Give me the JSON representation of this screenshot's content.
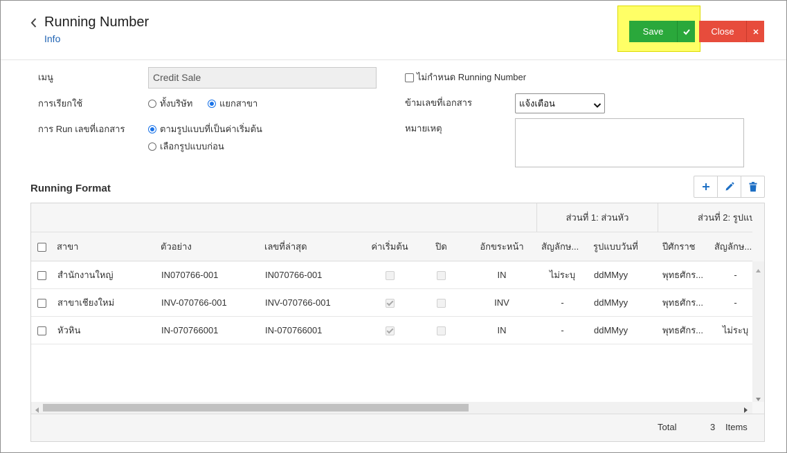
{
  "header": {
    "back_icon": "chevron-left-icon",
    "title": "Running Number",
    "subtitle": "Info",
    "save_label": "Save",
    "save_menu_icon": "check-icon",
    "close_label": "Close",
    "close_icon": "close-icon"
  },
  "form": {
    "menu": {
      "label": "เมนู",
      "value": "Credit Sale"
    },
    "usage": {
      "label": "การเรียกใช้",
      "options": [
        {
          "label": "ทั้งบริษัท",
          "checked": false
        },
        {
          "label": "แยกสาขา",
          "checked": true
        }
      ]
    },
    "run_mode": {
      "label": "การ Run เลขที่เอกสาร",
      "options": [
        {
          "label": "ตามรูปแบบที่เป็นค่าเริ่มต้น",
          "checked": true
        },
        {
          "label": "เลือกรูปแบบก่อน",
          "checked": false
        }
      ]
    },
    "no_running": {
      "label": "ไม่กำหนด Running Number",
      "checked": false
    },
    "skip_doc": {
      "label": "ข้ามเลขที่เอกสาร",
      "value": "แจ้งเตือน",
      "icon": "chevron-down-icon"
    },
    "remark": {
      "label": "หมายเหตุ"
    }
  },
  "grid": {
    "title": "Running Format",
    "toolbar": [
      {
        "icon": "plus-icon"
      },
      {
        "icon": "pencil-icon"
      },
      {
        "icon": "trash-icon"
      }
    ],
    "select_all_checked": false,
    "group_headers": [
      "ส่วนที่ 1: ส่วนหัว",
      "ส่วนที่ 2: รูปแบ"
    ],
    "columns": [
      "สาขา",
      "ตัวอย่าง",
      "เลขที่ล่าสุด",
      "ค่าเริ่มต้น",
      "ปิด",
      "อักขระหน้า",
      "สัญลักษ...",
      "รูปแบบวันที่",
      "ปีศักราช",
      "สัญลักษ..."
    ],
    "rows": [
      {
        "selected": false,
        "branch": "สำนักงานใหญ่",
        "example": "IN070766-001",
        "last_number": "IN070766-001",
        "is_default": false,
        "closed": false,
        "prefix": "IN",
        "symbol_1": "ไม่ระบุ",
        "date_format": "ddMMyy",
        "era": "พุทธศักร...",
        "symbol_2": "-"
      },
      {
        "selected": false,
        "branch": "สาขาเชียงใหม่",
        "example": "INV-070766-001",
        "last_number": "INV-070766-001",
        "is_default": true,
        "closed": false,
        "prefix": "INV",
        "symbol_1": "-",
        "date_format": "ddMMyy",
        "era": "พุทธศักร...",
        "symbol_2": "-"
      },
      {
        "selected": false,
        "branch": "หัวหิน",
        "example": "IN-070766001",
        "last_number": "IN-070766001",
        "is_default": true,
        "closed": false,
        "prefix": "IN",
        "symbol_1": "-",
        "date_format": "ddMMyy",
        "era": "พุทธศักร...",
        "symbol_2": "ไม่ระบุ"
      }
    ],
    "footer": {
      "total_label": "Total",
      "count": "3",
      "items_label": "Items"
    }
  },
  "colors": {
    "save": "#2aa83b",
    "close": "#e74c3c",
    "highlight": "#ffff66",
    "link": "#1f63b3",
    "toolbar_icon": "#1d6fc4",
    "radio_checked": "#1a73e8"
  }
}
